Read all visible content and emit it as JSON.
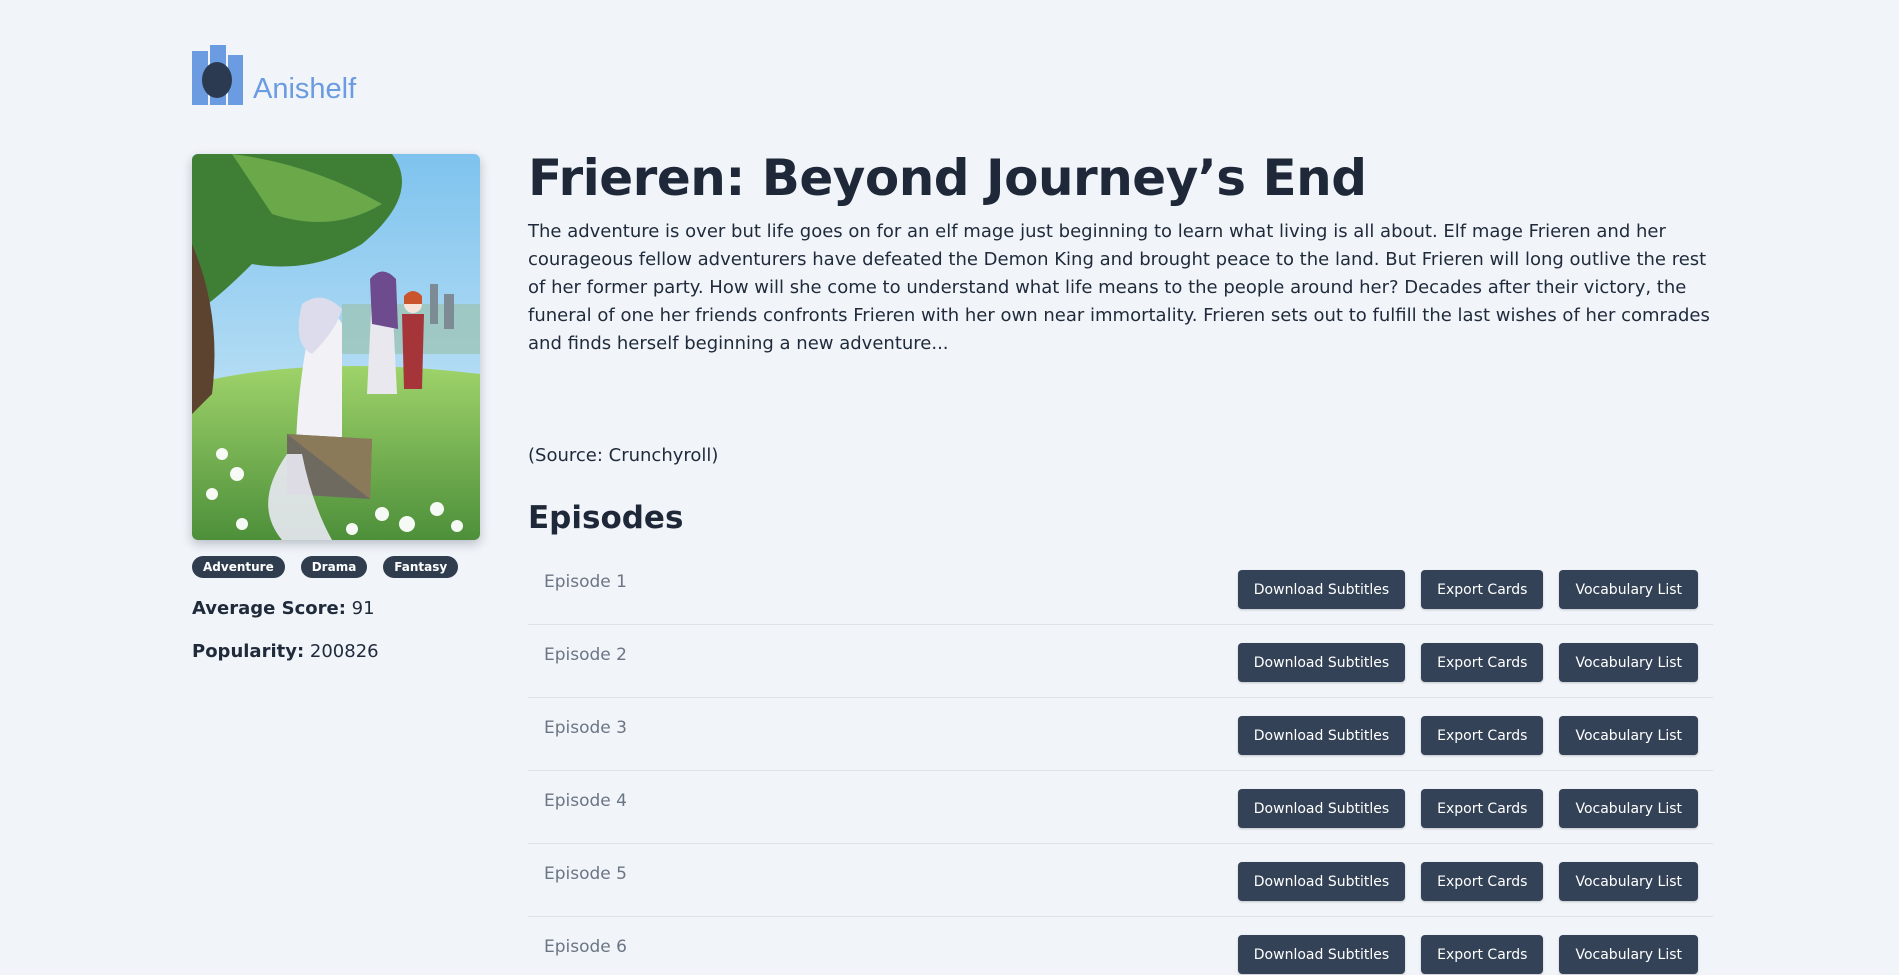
{
  "brand": {
    "name": "Anishelf",
    "accent": "#6b9be0"
  },
  "anime": {
    "title": "Frieren: Beyond Journey’s End",
    "description": "The adventure is over but life goes on for an elf mage just beginning to learn what living is all about. Elf mage Frieren and her courageous fellow adventurers have defeated the Demon King and brought peace to the land. But Frieren will long outlive the rest of her former party. How will she come to understand what life means to the people around her? Decades after their victory, the funeral of one her friends confronts Frieren with her own near immortality. Frieren sets out to fulfill the last wishes of her comrades and finds herself beginning a new adventure...",
    "source": "(Source: Crunchyroll)",
    "genres": [
      "Adventure",
      "Drama",
      "Fantasy"
    ],
    "score_label": "Average Score:",
    "score": "91",
    "popularity_label": "Popularity:",
    "popularity": "200826"
  },
  "episodes_heading": "Episodes",
  "episodes": [
    {
      "label": "Episode 1"
    },
    {
      "label": "Episode 2"
    },
    {
      "label": "Episode 3"
    },
    {
      "label": "Episode 4"
    },
    {
      "label": "Episode 5"
    },
    {
      "label": "Episode 6"
    }
  ],
  "actions": {
    "download": "Download Subtitles",
    "export": "Export Cards",
    "vocab": "Vocabulary List"
  }
}
